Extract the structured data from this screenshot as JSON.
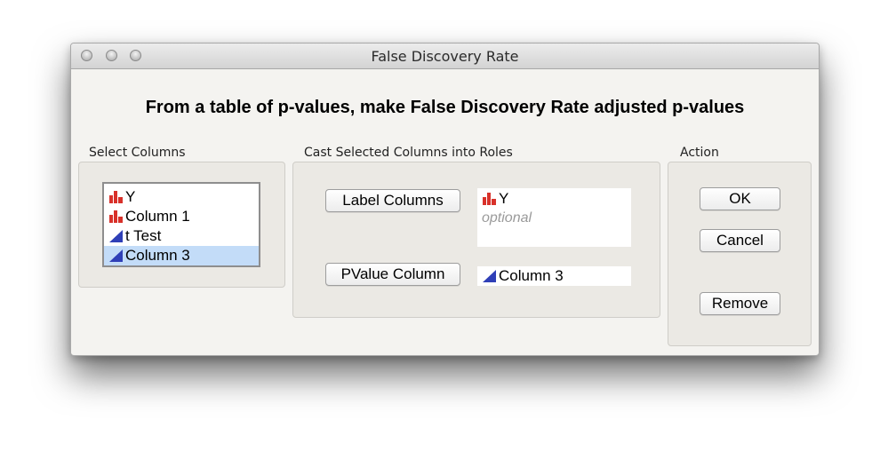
{
  "window": {
    "title": "False Discovery Rate"
  },
  "headline": "From a table of p-values, make False Discovery Rate adjusted p-values",
  "select_columns": {
    "label": "Select Columns",
    "items": [
      {
        "label": "Y",
        "icon": "nominal-bar-icon",
        "selected": false
      },
      {
        "label": "Column 1",
        "icon": "nominal-bar-icon",
        "selected": false
      },
      {
        "label": "t Test",
        "icon": "continuous-triangle-icon",
        "selected": false
      },
      {
        "label": "Column 3",
        "icon": "continuous-triangle-icon",
        "selected": true
      }
    ]
  },
  "roles": {
    "label": "Cast Selected Columns into Roles",
    "label_columns": {
      "button": "Label Columns",
      "value": "Y",
      "placeholder": "optional"
    },
    "pvalue_column": {
      "button": "PValue Column",
      "value": "Column 3"
    }
  },
  "action": {
    "label": "Action",
    "ok": "OK",
    "cancel": "Cancel",
    "remove": "Remove"
  },
  "colors": {
    "selection": "#c3dcf8",
    "nominal_icon": "#d8312a",
    "continuous_icon": "#2f3fb7",
    "placeholder": "#9a9a9a"
  }
}
